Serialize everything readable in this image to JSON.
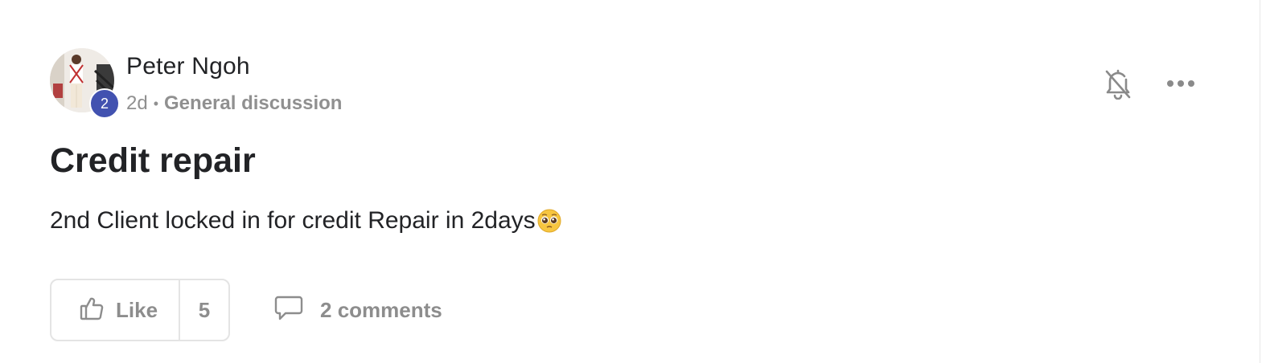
{
  "post": {
    "author": "Peter Ngoh",
    "level": "2",
    "age": "2d",
    "separator": "•",
    "category": "General discussion",
    "title": "Credit repair",
    "body": "2nd Client locked in for credit Repair in 2days",
    "body_emoji": "pleading-face-emoji"
  },
  "actions": {
    "like_label": "Like",
    "like_count": "5",
    "comments_label": "2 comments",
    "notification_icon": "bell-off-icon",
    "more_icon": "more-horizontal-icon"
  },
  "colors": {
    "level_badge": "#4252b0",
    "text": "#222326",
    "muted": "#909090",
    "border": "#e4e4e4"
  }
}
